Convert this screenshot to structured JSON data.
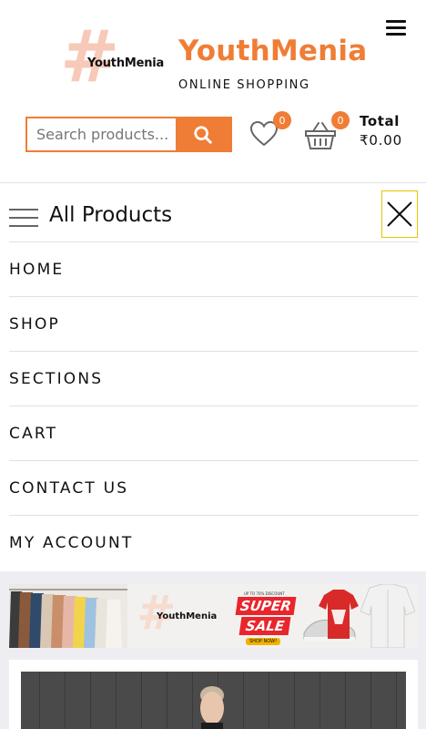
{
  "header": {
    "logo_mark_text": "YouthMenia",
    "brand_name": "YouthMenia",
    "tagline": "ONLINE SHOPPING",
    "search": {
      "placeholder": "Search products..."
    },
    "wishlist_count": "0",
    "cart_count": "0",
    "total_label": "Total",
    "total_value": "₹0.00"
  },
  "menu": {
    "title": "All Products",
    "items": [
      {
        "label": "HOME"
      },
      {
        "label": "SHOP"
      },
      {
        "label": "SECTIONS"
      },
      {
        "label": "CART"
      },
      {
        "label": "CONTACT US"
      },
      {
        "label": "MY ACCOUNT"
      }
    ]
  },
  "banner": {
    "logo_text": "YouthMenia",
    "fine_print": "UP TO 70% DISCOUNT",
    "super_text": "SUPER",
    "sale_text": "SALE",
    "cta": "SHOP NOW!"
  },
  "colors": {
    "accent": "#f07d35",
    "close_border": "#e8c400",
    "sale_red": "#e8262c"
  }
}
